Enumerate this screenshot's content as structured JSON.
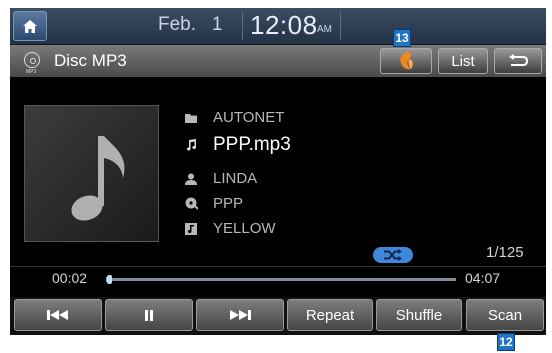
{
  "status_bar": {
    "month": "Feb.",
    "day": "1",
    "time": "12:08",
    "ampm": "AM"
  },
  "header": {
    "source_label": "Disc MP3",
    "disc_icon_sub": "MP3",
    "list_label": "List",
    "sound_icon": "orange-sound-effect-icon",
    "back_icon": "return-arrow-icon"
  },
  "track": {
    "folder": "AUTONET",
    "file": "PPP.mp3",
    "artist": "LINDA",
    "album": "PPP",
    "title": "YELLOW"
  },
  "playback": {
    "track_position": "1/125",
    "elapsed": "00:02",
    "total": "04:07",
    "progress_fraction": 0.008,
    "shuffle_active": true
  },
  "controls": {
    "repeat_label": "Repeat",
    "shuffle_label": "Shuffle",
    "scan_label": "Scan"
  },
  "callouts": {
    "sound_effect_callout": "13",
    "scan_callout": "12"
  },
  "colors": {
    "accent_blue": "#3f87d8",
    "callout_blue": "#1f74c4",
    "sound_icon_orange": "#f0881c"
  }
}
